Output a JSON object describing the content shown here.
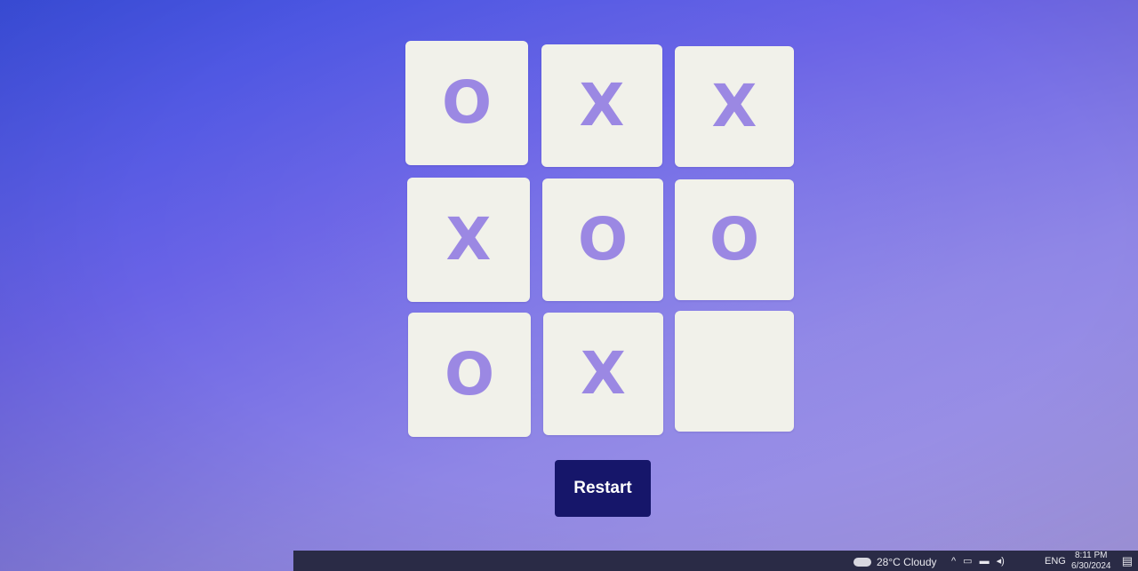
{
  "board": {
    "cells": [
      "O",
      "X",
      "X",
      "X",
      "O",
      "O",
      "O",
      "X",
      ""
    ]
  },
  "controls": {
    "restart_label": "Restart"
  },
  "taskbar": {
    "weather": "28°C Cloudy",
    "language": "ENG",
    "time": "8:11 PM",
    "date": "6/30/2024"
  },
  "colors": {
    "mark": "#9b88e3",
    "cell": "#f1f1ea",
    "restart_bg": "#16166a"
  }
}
